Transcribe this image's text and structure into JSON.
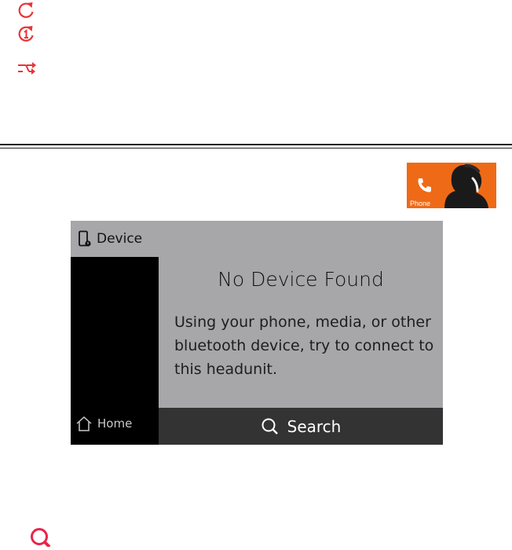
{
  "legend_icons": [
    {
      "icon": "repeat-icon"
    },
    {
      "icon": "repeat-one-icon"
    },
    {
      "icon": "shuffle-icon"
    }
  ],
  "phone_tile": {
    "label": "Phone",
    "icon": "phone-handset-icon",
    "color": "#ef6a16"
  },
  "screen": {
    "header": {
      "label": "Device",
      "icon": "device-phone-icon"
    },
    "title": "No Device Found",
    "message": "Using your phone, media, or other bluetooth device, try to connect to this headunit.",
    "search": {
      "label": "Search",
      "icon": "search-icon"
    },
    "home": {
      "label": "Home",
      "icon": "home-icon"
    },
    "colors": {
      "background": "#a7a6a8",
      "sidebar": "#000000",
      "searchbar": "#333333"
    }
  },
  "bottom_icon": {
    "icon": "search-icon",
    "color": "#e8254a"
  },
  "accent_color": "#e8343a"
}
